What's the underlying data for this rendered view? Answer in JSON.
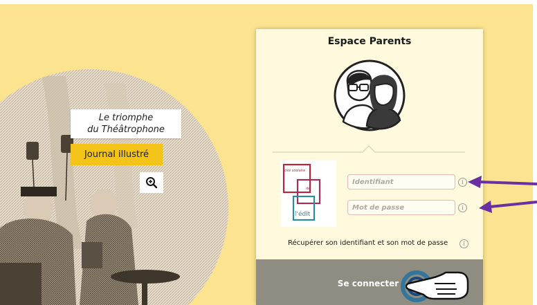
{
  "illustration": {
    "caption_line1": "Le triomphe",
    "caption_line2": "du Théâtrophone",
    "tag": "Journal illustré",
    "zoom_icon": "zoom-in-icon"
  },
  "login": {
    "title": "Espace Parents",
    "avatar_icon": "parents-avatar-icon",
    "logo_text": [
      "cité scolaire",
      "de",
      "l'édit"
    ],
    "identifiant_placeholder": "Identifiant",
    "password_placeholder": "Mot de passe",
    "info_icon_glyph": "i",
    "recover_link": "Récupérer son identifiant et son mot de passe",
    "connect_button": "Se connecter"
  },
  "colors": {
    "background": "#fbe38f",
    "panel": "#fff9de",
    "tag": "#f4c31a",
    "button": "#8f8c81",
    "annotation_arrow": "#6a2fa0",
    "logo_red": "#b0283c",
    "logo_magenta": "#a0305a",
    "logo_teal": "#2c8aa0"
  }
}
